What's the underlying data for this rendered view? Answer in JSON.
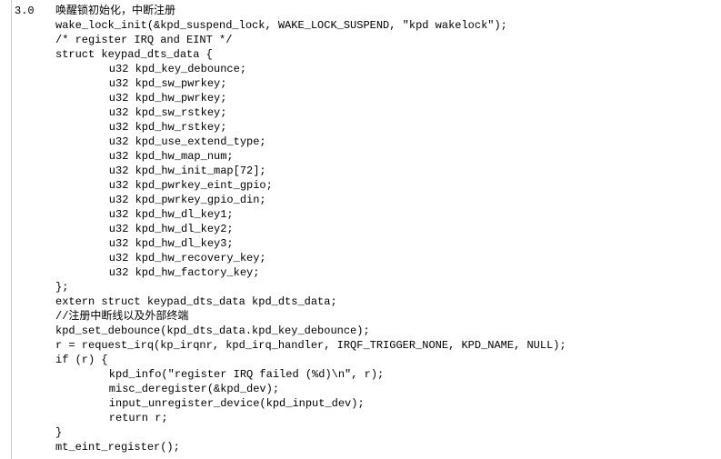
{
  "section_label": "3.0",
  "heading": "唤醒锁初始化，中断注册",
  "lines": [
    "wake_lock_init(&kpd_suspend_lock, WAKE_LOCK_SUSPEND, \"kpd wakelock\");",
    "/* register IRQ and EINT */",
    "struct keypad_dts_data {",
    "    u32 kpd_key_debounce;",
    "    u32 kpd_sw_pwrkey;",
    "    u32 kpd_hw_pwrkey;",
    "    u32 kpd_sw_rstkey;",
    "    u32 kpd_hw_rstkey;",
    "    u32 kpd_use_extend_type;",
    "    u32 kpd_hw_map_num;",
    "    u32 kpd_hw_init_map[72];",
    "    u32 kpd_pwrkey_eint_gpio;",
    "    u32 kpd_pwrkey_gpio_din;",
    "    u32 kpd_hw_dl_key1;",
    "    u32 kpd_hw_dl_key2;",
    "    u32 kpd_hw_dl_key3;",
    "    u32 kpd_hw_recovery_key;",
    "    u32 kpd_hw_factory_key;",
    "};",
    "extern struct keypad_dts_data kpd_dts_data;",
    "//注册中断线以及外部终端",
    "kpd_set_debounce(kpd_dts_data.kpd_key_debounce);",
    "r = request_irq(kp_irqnr, kpd_irq_handler, IRQF_TRIGGER_NONE, KPD_NAME, NULL);",
    "if (r) {",
    "    kpd_info(\"register IRQ failed (%d)\\n\", r);",
    "    misc_deregister(&kpd_dev);",
    "    input_unregister_device(kpd_input_dev);",
    "    return r;",
    "}",
    "mt_eint_register();"
  ],
  "indent_codes": [
    0,
    0,
    0,
    1,
    1,
    1,
    1,
    1,
    1,
    1,
    1,
    1,
    1,
    1,
    1,
    1,
    1,
    1,
    0,
    0,
    0,
    0,
    0,
    0,
    1,
    1,
    1,
    1,
    0,
    0
  ]
}
